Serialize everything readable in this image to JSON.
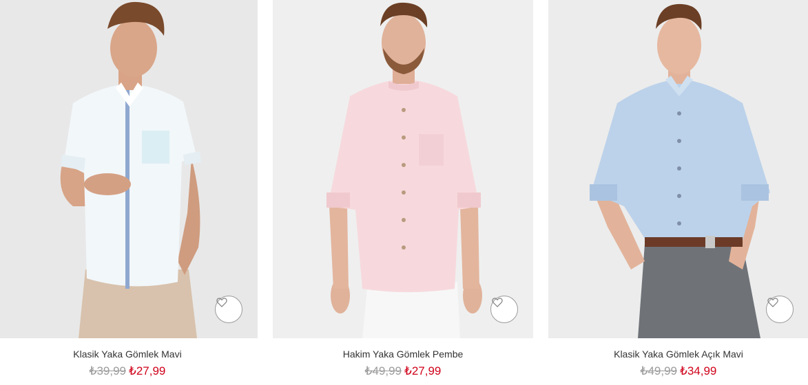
{
  "products": [
    {
      "name": "Klasik Yaka Gömlek Mavi",
      "old_price": "₺39,99",
      "new_price": "₺27,99",
      "shirt_color": "#f2f7fa",
      "pants_color": "#d8c2ad",
      "accent_color": "#8fa8cf"
    },
    {
      "name": "Hakim Yaka Gömlek Pembe",
      "old_price": "₺49,99",
      "new_price": "₺27,99",
      "shirt_color": "#f7d9dd",
      "pants_color": "#f5f5f5",
      "accent_color": "#d8b4b9"
    },
    {
      "name": "Klasik Yaka Gömlek Açık Mavi",
      "old_price": "₺49,99",
      "new_price": "₺34,99",
      "shirt_color": "#bcd2ea",
      "pants_color": "#6f7378",
      "accent_color": "#6b3b27"
    }
  ],
  "icons": {
    "favorite": "heart-outline-icon"
  },
  "colors": {
    "price_sale": "#d0021b",
    "price_old": "#9b9b9b",
    "text": "#333333"
  }
}
